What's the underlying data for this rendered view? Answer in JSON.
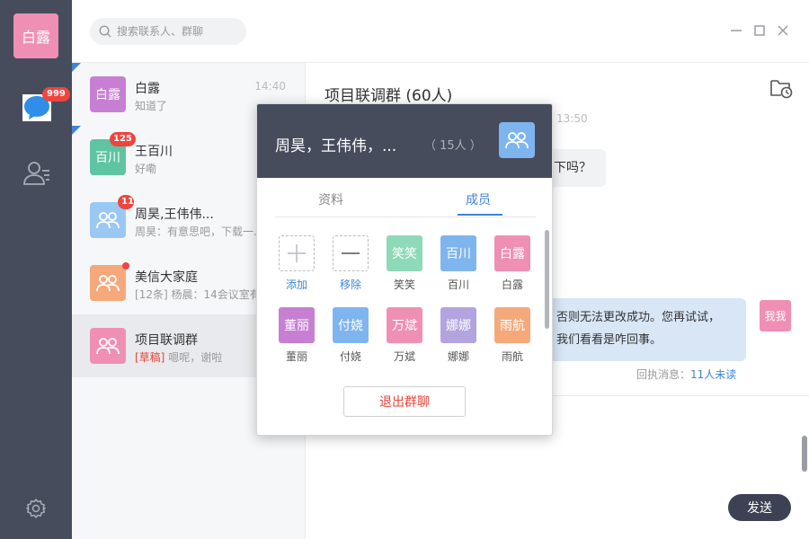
{
  "user": {
    "avatar_text": "白露",
    "avatar_color": "#f08fb4"
  },
  "nav": {
    "chat_badge": "999"
  },
  "search": {
    "placeholder": "搜索联系人、群聊"
  },
  "conversations": [
    {
      "avatar_text": "白露",
      "avatar_color": "#c77fd4",
      "name": "白露",
      "preview": "知道了",
      "time": "14:40",
      "badge": "",
      "dot": false,
      "corner": true
    },
    {
      "avatar_text": "百川",
      "avatar_color": "#5fc4a2",
      "name": "王百川",
      "preview": "好嘞",
      "time": "",
      "badge": "125",
      "dot": false,
      "corner": true
    },
    {
      "avatar_text": "",
      "avatar_color": "#9bc8f2",
      "name": "周昊,王伟伟...",
      "preview": "周昊：有意思吧，下载一...",
      "time": "",
      "badge": "11",
      "dot": false,
      "corner": false
    },
    {
      "avatar_text": "",
      "avatar_color": "#f5a97b",
      "name": "美信大家庭",
      "preview": "[12条] 杨晨：14会议室有...",
      "time": "",
      "badge": "",
      "dot": true,
      "corner": false
    },
    {
      "avatar_text": "",
      "avatar_color": "#f08fb4",
      "name": "项目联调群",
      "draft_tag": "[草稿]",
      "preview": " 嗯呢，谢啦",
      "time": "",
      "badge": "",
      "dot": false,
      "corner": false
    }
  ],
  "chat": {
    "title": "项目联调群 (60人)",
    "time": "13:50",
    "incoming_text": "下吗？",
    "outgoing_line1": "否则无法更改成功。您再试试，",
    "outgoing_line2": "我们看看是咋回事。",
    "self_avatar_text": "我我",
    "receipt_label": "回执消息：",
    "receipt_unread": "11人未读",
    "send_label": "发送"
  },
  "popup": {
    "title": "周昊，王伟伟，...",
    "count": "（ 15人 ）",
    "tabs": [
      "资料",
      "成员"
    ],
    "active_tab": "成员",
    "actions": [
      {
        "label": "添加"
      },
      {
        "label": "移除"
      }
    ],
    "members": [
      {
        "name": "笑笑",
        "avatar_text": "笑笑",
        "color": "#8ed9b8"
      },
      {
        "name": "百川",
        "avatar_text": "百川",
        "color": "#7fb5ee"
      },
      {
        "name": "白露",
        "avatar_text": "白露",
        "color": "#f08fb4"
      },
      {
        "name": "董丽",
        "avatar_text": "董丽",
        "color": "#c77fd4"
      },
      {
        "name": "付娆",
        "avatar_text": "付娆",
        "color": "#7fb5ee"
      },
      {
        "name": "万斌",
        "avatar_text": "万斌",
        "color": "#f08fb4"
      },
      {
        "name": "娜娜",
        "avatar_text": "娜娜",
        "color": "#b3a4e0"
      },
      {
        "name": "雨航",
        "avatar_text": "雨航",
        "color": "#f5a97b"
      }
    ],
    "quit_label": "退出群聊"
  },
  "colors": {
    "rail": "#474c5c",
    "accent": "#3f84d9",
    "danger": "#f0443e"
  },
  "icons": [
    "chat-bubble-icon",
    "contacts-icon",
    "settings-gear-icon",
    "search-icon",
    "minimize-icon",
    "maximize-icon",
    "close-icon",
    "folder-clock-icon",
    "group-icon"
  ]
}
